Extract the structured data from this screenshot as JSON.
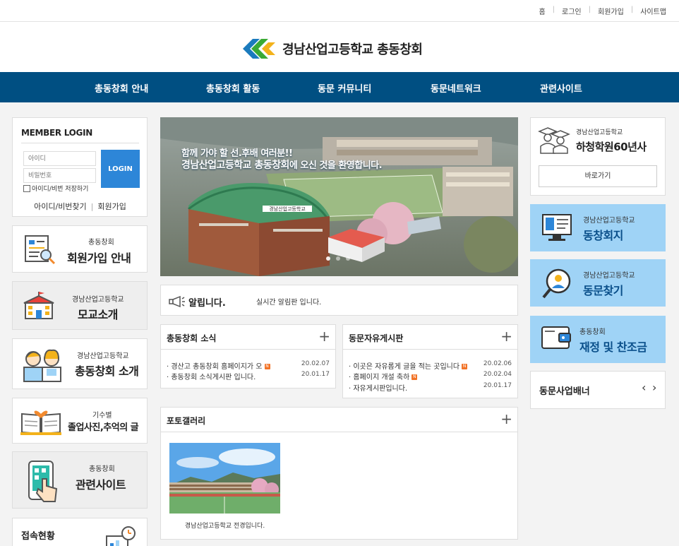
{
  "top_links": [
    "홈",
    "로그인",
    "회원가입",
    "사이트맵"
  ],
  "site_title": "경남산업고등학교 총동창회",
  "colors": {
    "nav_bg": "#004f82",
    "login_btn": "#2d86d8",
    "right_card_bg": "#9fd3f6",
    "new_badge": "#f27327"
  },
  "nav": [
    "총동창회 안내",
    "총동창회 활동",
    "동문 커뮤니티",
    "동문네트워크",
    "관련사이트"
  ],
  "login": {
    "title": "MEMBER LOGIN",
    "id_placeholder": "아이디",
    "pw_placeholder": "비밀번호",
    "button": "LOGIN",
    "save_label": "아이디/비번 저장하기",
    "find_link": "아이디/비번찾기",
    "join_link": "회원가입"
  },
  "left_cards": [
    {
      "sub": "총동창회",
      "main": "회원가입 안내",
      "icon": "signup-form-icon"
    },
    {
      "sub": "경남산업고등학교",
      "main": "모교소개",
      "icon": "school-building-icon"
    },
    {
      "sub": "경남산업고등학교",
      "main": "총동창회 소개",
      "icon": "students-icon"
    },
    {
      "sub": "기수별",
      "main": "졸업사진,추억의 글",
      "icon": "open-book-heart-icon"
    },
    {
      "sub": "총동창회",
      "main": "관련사이트",
      "icon": "tablet-touch-icon"
    }
  ],
  "visitors": {
    "title": "접속현황"
  },
  "banner": {
    "line1": "함께 가야 할 선.후배 여러분!!",
    "line2_highlight": "경남산업고등학교 총동창회",
    "line2_rest": "에 오신 것을 환영합니다.",
    "gym_sign": "경남산업고등학교"
  },
  "notice": {
    "title": "알립니다.",
    "text": "실시간 알림판 입니다."
  },
  "news": {
    "title": "총동창회 소식",
    "posts": [
      {
        "title": "경산고 총동창회 홈페이지가 오",
        "date": "20.02.07",
        "new": true
      },
      {
        "title": "총동창회 소식게시판 입니다.",
        "date": "20.01.17",
        "new": false
      }
    ]
  },
  "free_board": {
    "title": "동문자유게시판",
    "posts": [
      {
        "title": "이곳은 자유롭게 글을 적는 곳입니다",
        "date": "20.02.06",
        "new": true
      },
      {
        "title": "홈페이지 개설 축하",
        "date": "20.02.04",
        "new": true
      },
      {
        "title": "자유게시판입니다.",
        "date": "20.01.17",
        "new": false
      }
    ]
  },
  "new_badge": "N",
  "gallery": {
    "title": "포토갤러리",
    "caption": "경남산업고등학교 전경입니다."
  },
  "history": {
    "sub": "경남산업고등학교",
    "main": "하청학원60년사",
    "button": "바로가기"
  },
  "right_cards": [
    {
      "sub": "경남산업고등학교",
      "main": "동창회지",
      "icon": "monitor-document-icon"
    },
    {
      "sub": "경남산업고등학교",
      "main": "동문찾기",
      "icon": "magnifier-person-icon"
    },
    {
      "sub": "총동창회",
      "main": "재정 및 찬조금",
      "icon": "wallet-icon"
    }
  ],
  "partner_banner": {
    "title": "동문사업배너"
  }
}
